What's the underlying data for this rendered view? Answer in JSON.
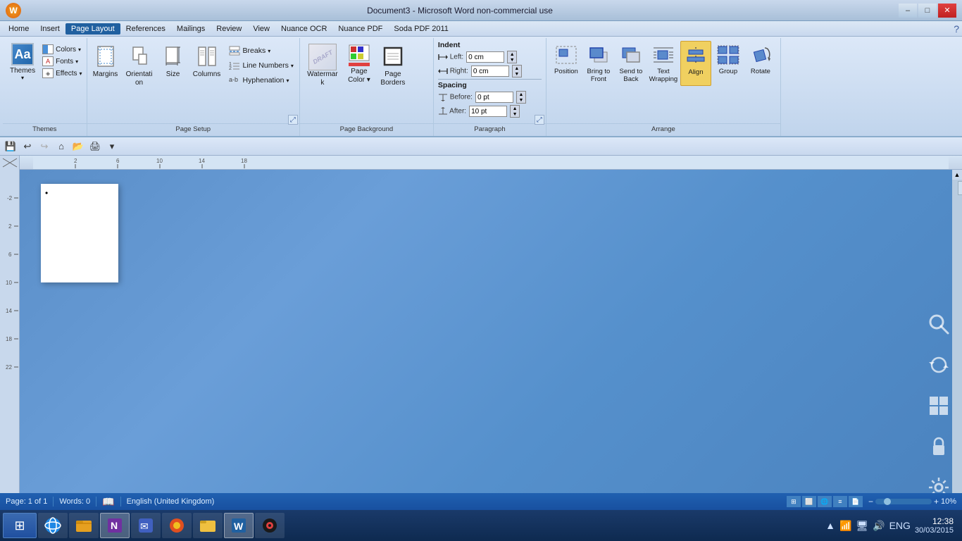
{
  "app": {
    "title": "Document3 - Microsoft Word non-commercial use",
    "icon_label": "W"
  },
  "window_controls": {
    "minimize": "–",
    "maximize": "□",
    "close": "✕"
  },
  "menu": {
    "items": [
      "Home",
      "Insert",
      "Page Layout",
      "References",
      "Mailings",
      "Review",
      "View",
      "Nuance OCR",
      "Nuance PDF",
      "Soda PDF 2011"
    ],
    "active": "Page Layout"
  },
  "ribbon": {
    "themes_group": {
      "label": "Themes",
      "main_label": "Themes",
      "colors_label": "Colors",
      "fonts_label": "Fonts",
      "effects_label": "Effects",
      "arrow": "▾"
    },
    "page_setup_group": {
      "label": "Page Setup",
      "margins_label": "Margins",
      "orientation_label": "Orientation",
      "size_label": "Size",
      "columns_label": "Columns",
      "breaks_label": "Breaks",
      "line_numbers_label": "Line Numbers",
      "hyphenation_label": "Hyphenation",
      "expand_icon": "⤢"
    },
    "page_bg_group": {
      "label": "Page Background",
      "watermark_label": "Watermark",
      "page_color_label": "Page\nColor",
      "page_borders_label": "Page\nBorders"
    },
    "paragraph_group": {
      "label": "Paragraph",
      "indent_label": "Indent",
      "left_label": "Left:",
      "left_value": "0 cm",
      "right_label": "Right:",
      "right_value": "0 cm",
      "spacing_label": "Spacing",
      "before_label": "Before:",
      "before_value": "0 pt",
      "after_label": "After:",
      "after_value": "10 pt",
      "expand_icon": "⤢"
    },
    "arrange_group": {
      "label": "Arrange",
      "position_label": "Position",
      "bring_to_front_label": "Bring to\nFront",
      "send_to_back_label": "Send to\nBack",
      "text_wrapping_label": "Text\nWrapping",
      "align_label": "Align",
      "group_label": "Group",
      "rotate_label": "Rotate"
    }
  },
  "toolbar": {
    "save_icon": "💾",
    "undo_icon": "↩",
    "redo_icon": "↪",
    "open_icon": "📂",
    "print_icon": "🖨",
    "dropdown_icon": "▾"
  },
  "ruler": {
    "ticks": [
      "2",
      "6",
      "10",
      "14",
      "18"
    ]
  },
  "document": {
    "cursor_char": "•"
  },
  "status_bar": {
    "page_info": "Page: 1 of 1",
    "words_label": "Words: 0",
    "language": "English (United Kingdom)",
    "zoom_pct": "10%",
    "views": [
      "⊞",
      "≡",
      "☰",
      "▭",
      "⊡"
    ]
  },
  "taskbar": {
    "start_icon": "⊞",
    "pins": [
      {
        "icon": "🌐",
        "label": "IE",
        "active": false
      },
      {
        "icon": "📁",
        "label": "Explorer",
        "active": false
      },
      {
        "icon": "📘",
        "label": "OneNote",
        "active": false
      },
      {
        "icon": "🦋",
        "label": "App",
        "active": false
      },
      {
        "icon": "🦊",
        "label": "Firefox",
        "active": false
      },
      {
        "icon": "📂",
        "label": "Folder",
        "active": false
      },
      {
        "icon": "📝",
        "label": "Word",
        "active": true
      },
      {
        "icon": "🎵",
        "label": "Media",
        "active": false
      }
    ],
    "tray": {
      "arrow": "▲",
      "wifi": "📶",
      "battery": "🔋",
      "volume": "🔊",
      "clock_time": "12:38",
      "clock_date": "30/03/2015",
      "lang": "ENG"
    }
  },
  "side_icons": {
    "search": "🔍",
    "sync": "🔄",
    "windows": "⊞",
    "lock": "⏏",
    "settings": "⚙"
  }
}
